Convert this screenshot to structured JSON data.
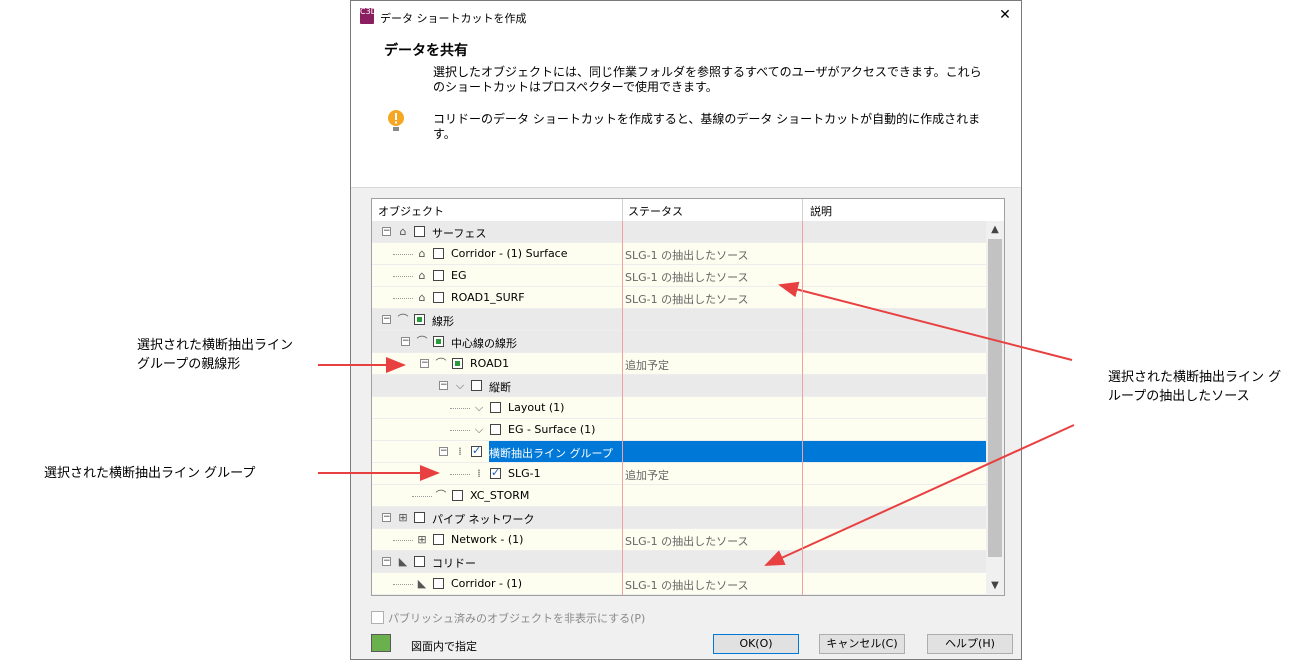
{
  "dialog": {
    "title": "データ ショートカットを作成",
    "app_icon": "C3D",
    "close": "✕",
    "heading": "データを共有",
    "description": "選択したオブジェクトには、同じ作業フォルダを参照するすべてのユーザがアクセスできます。これらのショートカットはプロスペクターで使用できます。",
    "warning_text": "コリドーのデータ ショートカットを作成すると、基線のデータ ショートカットが自動的に作成されます。",
    "columns": [
      "オブジェクト",
      "ステータス",
      "説明"
    ],
    "rows": [
      {
        "label": "サーフェス",
        "status": "",
        "icon": "surface-icon"
      },
      {
        "label": "Corridor - (1) Surface",
        "status": "SLG-1 の抽出したソース",
        "icon": "surface-icon"
      },
      {
        "label": "EG",
        "status": "SLG-1 の抽出したソース",
        "icon": "surface-icon"
      },
      {
        "label": "ROAD1_SURF",
        "status": "SLG-1 の抽出したソース",
        "icon": "surface-icon"
      },
      {
        "label": "線形",
        "status": "",
        "icon": "alignment-icon"
      },
      {
        "label": "中心線の線形",
        "status": "",
        "icon": "alignment-icon"
      },
      {
        "label": "ROAD1",
        "status": "追加予定",
        "icon": "alignment-icon"
      },
      {
        "label": "縦断",
        "status": "",
        "icon": "profile-icon"
      },
      {
        "label": "Layout (1)",
        "status": "",
        "icon": "profile-icon"
      },
      {
        "label": "EG - Surface (1)",
        "status": "",
        "icon": "profile-icon"
      },
      {
        "label": "横断抽出ライン グループ",
        "status": "",
        "icon": "sample-line-group-icon"
      },
      {
        "label": "SLG-1",
        "status": "追加予定",
        "icon": "sample-line-group-icon"
      },
      {
        "label": "XC_STORM",
        "status": "",
        "icon": "alignment-icon"
      },
      {
        "label": "パイプ ネットワーク",
        "status": "",
        "icon": "pipe-network-icon"
      },
      {
        "label": "Network - (1)",
        "status": "SLG-1 の抽出したソース",
        "icon": "pipe-network-icon"
      },
      {
        "label": "コリドー",
        "status": "",
        "icon": "corridor-icon"
      },
      {
        "label": "Corridor - (1)",
        "status": "SLG-1 の抽出したソース",
        "icon": "corridor-icon"
      }
    ],
    "hide_published": "パブリッシュ済みのオブジェクトを非表示にする(P)",
    "pick_label": "図面内で指定",
    "buttons": {
      "ok": "OK(O)",
      "cancel": "キャンセル(C)",
      "help": "ヘルプ(H)"
    }
  },
  "annotations": {
    "parent_alignment": "選択された横断抽出ライン グループの親線形",
    "sample_line_group": "選択された横断抽出ライン グループ",
    "extracted_source": "選択された横断抽出ライン グループの抽出したソース"
  },
  "colors": {
    "selection": "#0078d7",
    "arrow": "#e84040",
    "warning": "#f5a623"
  }
}
